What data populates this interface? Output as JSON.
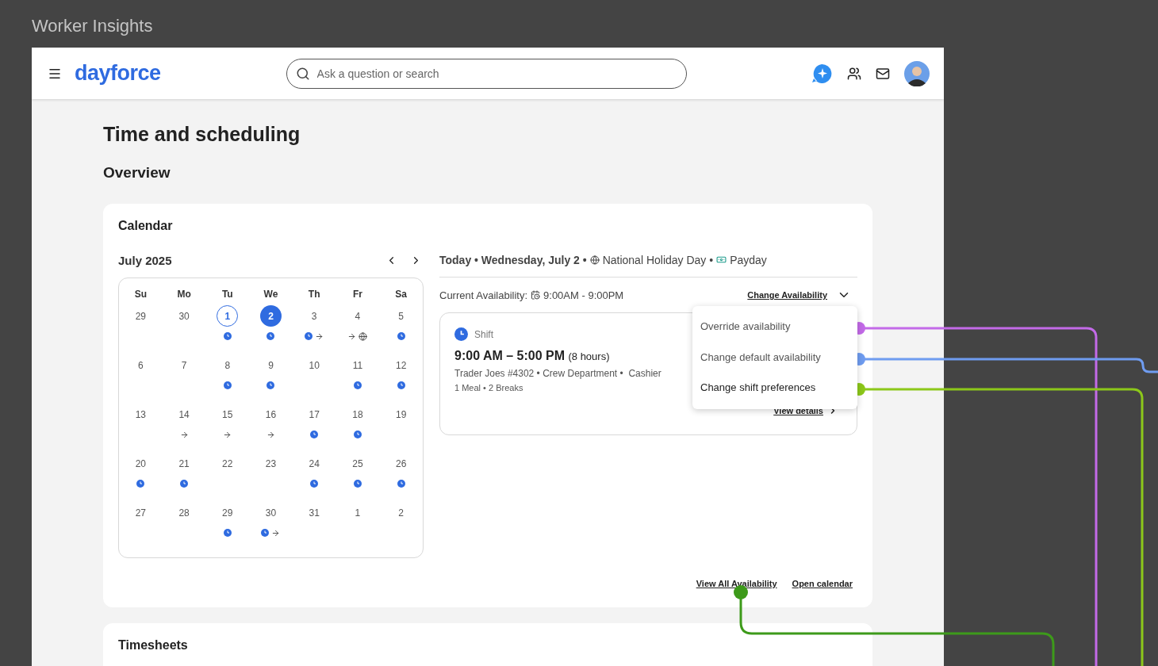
{
  "page_title": "Worker Insights",
  "header": {
    "logo": "dayforce",
    "search": {
      "placeholder": "Ask a question or search"
    }
  },
  "title": "Time and scheduling",
  "section": "Overview",
  "calendar": {
    "title": "Calendar",
    "month": "July 2025",
    "weekdays": [
      "Su",
      "Mo",
      "Tu",
      "We",
      "Th",
      "Fr",
      "Sa"
    ],
    "weeks": [
      [
        {
          "day": "29",
          "selected": false,
          "outlined": false
        },
        {
          "day": "30",
          "selected": false,
          "outlined": false
        },
        {
          "day": "1",
          "selected": false,
          "outlined": true,
          "events": [
            {
              "kind": "shift"
            }
          ]
        },
        {
          "day": "2",
          "selected": true,
          "outlined": false,
          "events": [
            {
              "kind": "shift"
            }
          ]
        },
        {
          "day": "3",
          "selected": false,
          "outlined": false,
          "events": [
            {
              "kind": "shift"
            },
            {
              "kind": "transfer"
            }
          ]
        },
        {
          "day": "4",
          "selected": false,
          "outlined": false,
          "events": [
            {
              "kind": "transfer"
            },
            {
              "kind": "holiday"
            }
          ]
        },
        {
          "day": "5",
          "selected": false,
          "outlined": false,
          "events": [
            {
              "kind": "shift"
            }
          ]
        }
      ],
      [
        {
          "day": "6",
          "selected": false,
          "outlined": false
        },
        {
          "day": "7",
          "selected": false,
          "outlined": false
        },
        {
          "day": "8",
          "selected": false,
          "outlined": false,
          "events": [
            {
              "kind": "shift"
            }
          ]
        },
        {
          "day": "9",
          "selected": false,
          "outlined": false,
          "events": [
            {
              "kind": "shift"
            }
          ]
        },
        {
          "day": "10",
          "selected": false,
          "outlined": false
        },
        {
          "day": "11",
          "selected": false,
          "outlined": false,
          "events": [
            {
              "kind": "shift"
            }
          ]
        },
        {
          "day": "12",
          "selected": false,
          "outlined": false,
          "events": [
            {
              "kind": "shift"
            }
          ]
        }
      ],
      [
        {
          "day": "13",
          "selected": false,
          "outlined": false
        },
        {
          "day": "14",
          "selected": false,
          "outlined": false,
          "events": [
            {
              "kind": "transfer"
            }
          ]
        },
        {
          "day": "15",
          "selected": false,
          "outlined": false,
          "events": [
            {
              "kind": "transfer"
            }
          ]
        },
        {
          "day": "16",
          "selected": false,
          "outlined": false,
          "events": [
            {
              "kind": "transfer"
            }
          ]
        },
        {
          "day": "17",
          "selected": false,
          "outlined": false,
          "events": [
            {
              "kind": "shift"
            }
          ]
        },
        {
          "day": "18",
          "selected": false,
          "outlined": false,
          "events": [
            {
              "kind": "shift"
            }
          ]
        },
        {
          "day": "19",
          "selected": false,
          "outlined": false
        }
      ],
      [
        {
          "day": "20",
          "selected": false,
          "outlined": false,
          "events": [
            {
              "kind": "shift"
            }
          ]
        },
        {
          "day": "21",
          "selected": false,
          "outlined": false,
          "events": [
            {
              "kind": "shift"
            }
          ]
        },
        {
          "day": "22",
          "selected": false,
          "outlined": false
        },
        {
          "day": "23",
          "selected": false,
          "outlined": false
        },
        {
          "day": "24",
          "selected": false,
          "outlined": false,
          "events": [
            {
              "kind": "shift"
            }
          ]
        },
        {
          "day": "25",
          "selected": false,
          "outlined": false,
          "events": [
            {
              "kind": "shift"
            }
          ]
        },
        {
          "day": "26",
          "selected": false,
          "outlined": false,
          "events": [
            {
              "kind": "shift"
            }
          ]
        }
      ],
      [
        {
          "day": "27",
          "selected": false,
          "outlined": false
        },
        {
          "day": "28",
          "selected": false,
          "outlined": false
        },
        {
          "day": "29",
          "selected": false,
          "outlined": false,
          "events": [
            {
              "kind": "shift"
            }
          ]
        },
        {
          "day": "30",
          "selected": false,
          "outlined": false,
          "events": [
            {
              "kind": "shift"
            },
            {
              "kind": "transfer"
            }
          ]
        },
        {
          "day": "31",
          "selected": false,
          "outlined": false
        },
        {
          "day": "1",
          "selected": false,
          "outlined": false
        },
        {
          "day": "2",
          "selected": false,
          "outlined": false
        }
      ]
    ]
  },
  "today": {
    "date": "Today • Wednesday, July 2 •",
    "holiday": "National Holiday Day •",
    "payday": "Payday"
  },
  "availability": {
    "label": "Current Availability:",
    "hours": "9:00AM - 9:00PM",
    "action": "Change Availability",
    "expanded": true
  },
  "menu": [
    {
      "label": "Override availability"
    },
    {
      "label": "Change default availability"
    },
    {
      "label": "Change shift preferences"
    }
  ],
  "shift": {
    "type": "Shift",
    "time": "9:00 AM – 5:00 PM",
    "duration": "(8 hours)",
    "details": "Trader Joes #4302 • Crew Department •  Cashier",
    "breaks": "1 Meal • 2 Breaks",
    "link": "View details"
  },
  "links": [
    "View All Availability",
    "Open calendar"
  ],
  "timesheets": {
    "title": "Timesheets"
  },
  "annotations": [
    {
      "color": "#c36ae8"
    },
    {
      "color": "#6f9cf0"
    },
    {
      "color": "#8cc81a"
    },
    {
      "color": "#3d9a1a"
    }
  ]
}
